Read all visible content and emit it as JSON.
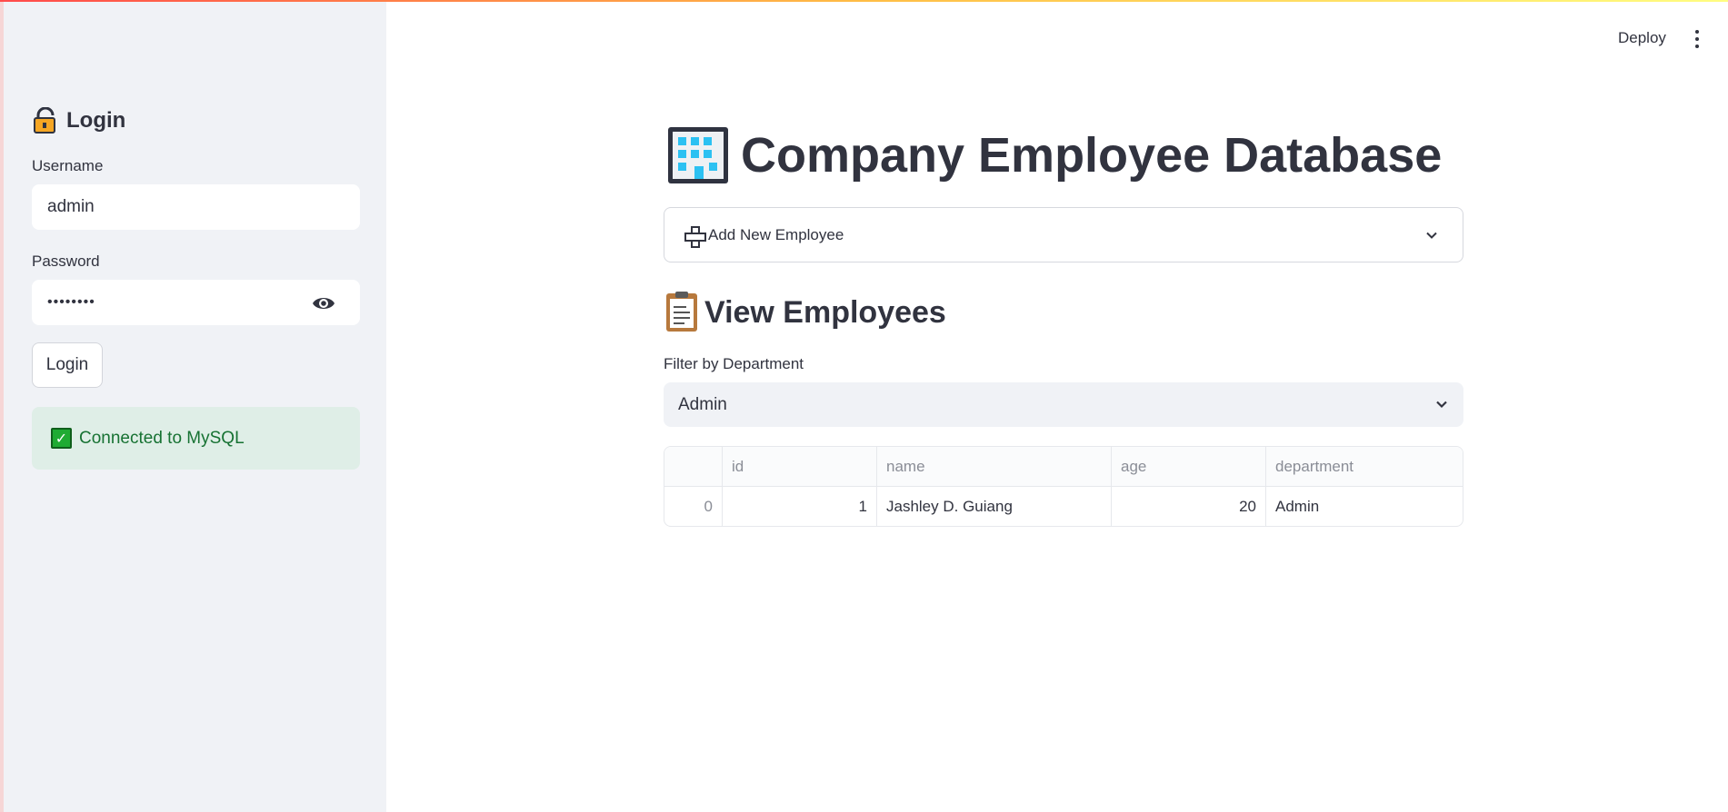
{
  "sidebar": {
    "login_title": "Login",
    "username_label": "Username",
    "username_value": "admin",
    "password_label": "Password",
    "password_value": "••••••••",
    "login_button": "Login",
    "status_message": "Connected to MySQL"
  },
  "header": {
    "deploy_label": "Deploy"
  },
  "main": {
    "title": "Company Employee Database",
    "expander_label": "Add New Employee",
    "section_title": "View Employees",
    "filter_label": "Filter by Department",
    "filter_value": "Admin",
    "table": {
      "columns": [
        "",
        "id",
        "name",
        "age",
        "department"
      ],
      "rows": [
        [
          "0",
          "1",
          "Jashley D. Guiang",
          "20",
          "Admin"
        ]
      ]
    }
  },
  "colors": {
    "sidebar_bg": "#f0f2f6",
    "success_bg": "#dfeee7",
    "success_text": "#177233",
    "text": "#31333f"
  }
}
